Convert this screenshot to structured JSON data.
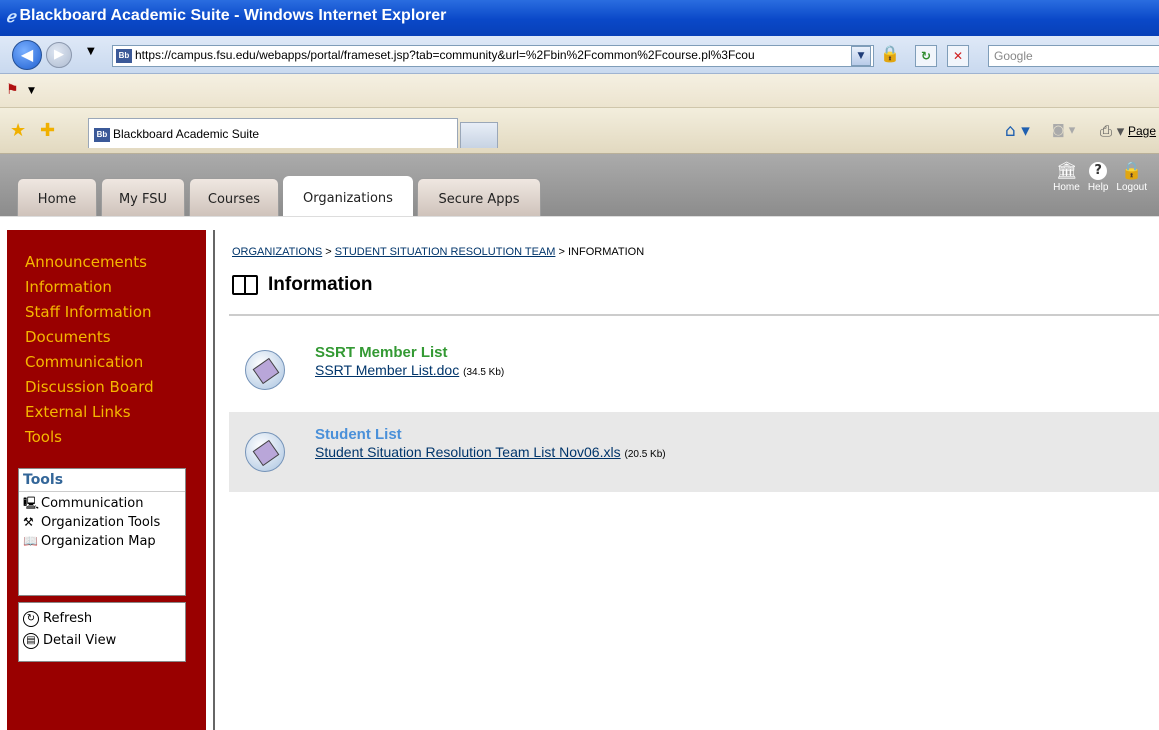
{
  "window": {
    "title": "Blackboard Academic Suite - Windows Internet Explorer"
  },
  "addressbar": {
    "url": "https://campus.fsu.edu/webapps/portal/frameset.jsp?tab=community&url=%2Fbin%2Fcommon%2Fcourse.pl%3Fcou",
    "search_placeholder": "Google"
  },
  "favbar": {
    "tab_title": "Blackboard Academic Suite",
    "page_label": "Page"
  },
  "portal": {
    "tabs": [
      {
        "label": "Home"
      },
      {
        "label": "My FSU"
      },
      {
        "label": "Courses"
      },
      {
        "label": "Organizations"
      },
      {
        "label": "Secure Apps"
      }
    ],
    "top_links": {
      "home": "Home",
      "help": "Help",
      "logout": "Logout"
    }
  },
  "course_menu": [
    "Announcements",
    "Information",
    "Staff Information",
    "Documents",
    "Communication",
    "Discussion Board",
    "External Links",
    "Tools"
  ],
  "tools_box": {
    "header": "Tools",
    "items": [
      {
        "label": "Communication",
        "icon": "computer-icon"
      },
      {
        "label": "Organization Tools",
        "icon": "tools-icon"
      },
      {
        "label": "Organization Map",
        "icon": "map-icon"
      }
    ]
  },
  "refresh_box": {
    "refresh": "Refresh",
    "detail_view": "Detail View"
  },
  "content": {
    "breadcrumb": {
      "part1": "Organizations",
      "sep": " > ",
      "part2": "Student Situation Resolution Team",
      "part3": "Information"
    },
    "page_title": "Information",
    "items": [
      {
        "title": "SSRT Member List",
        "file": "SSRT Member List.doc",
        "size": "(34.5 Kb)",
        "title_color": "#339933"
      },
      {
        "title": "Student List",
        "file": "Student Situation Resolution Team List Nov06.xls",
        "size": "(20.5 Kb)",
        "title_color": "#4a90d9"
      }
    ]
  },
  "colors": {
    "nav_bg": "#990000",
    "nav_link": "#f5b700",
    "link": "#00356b"
  }
}
